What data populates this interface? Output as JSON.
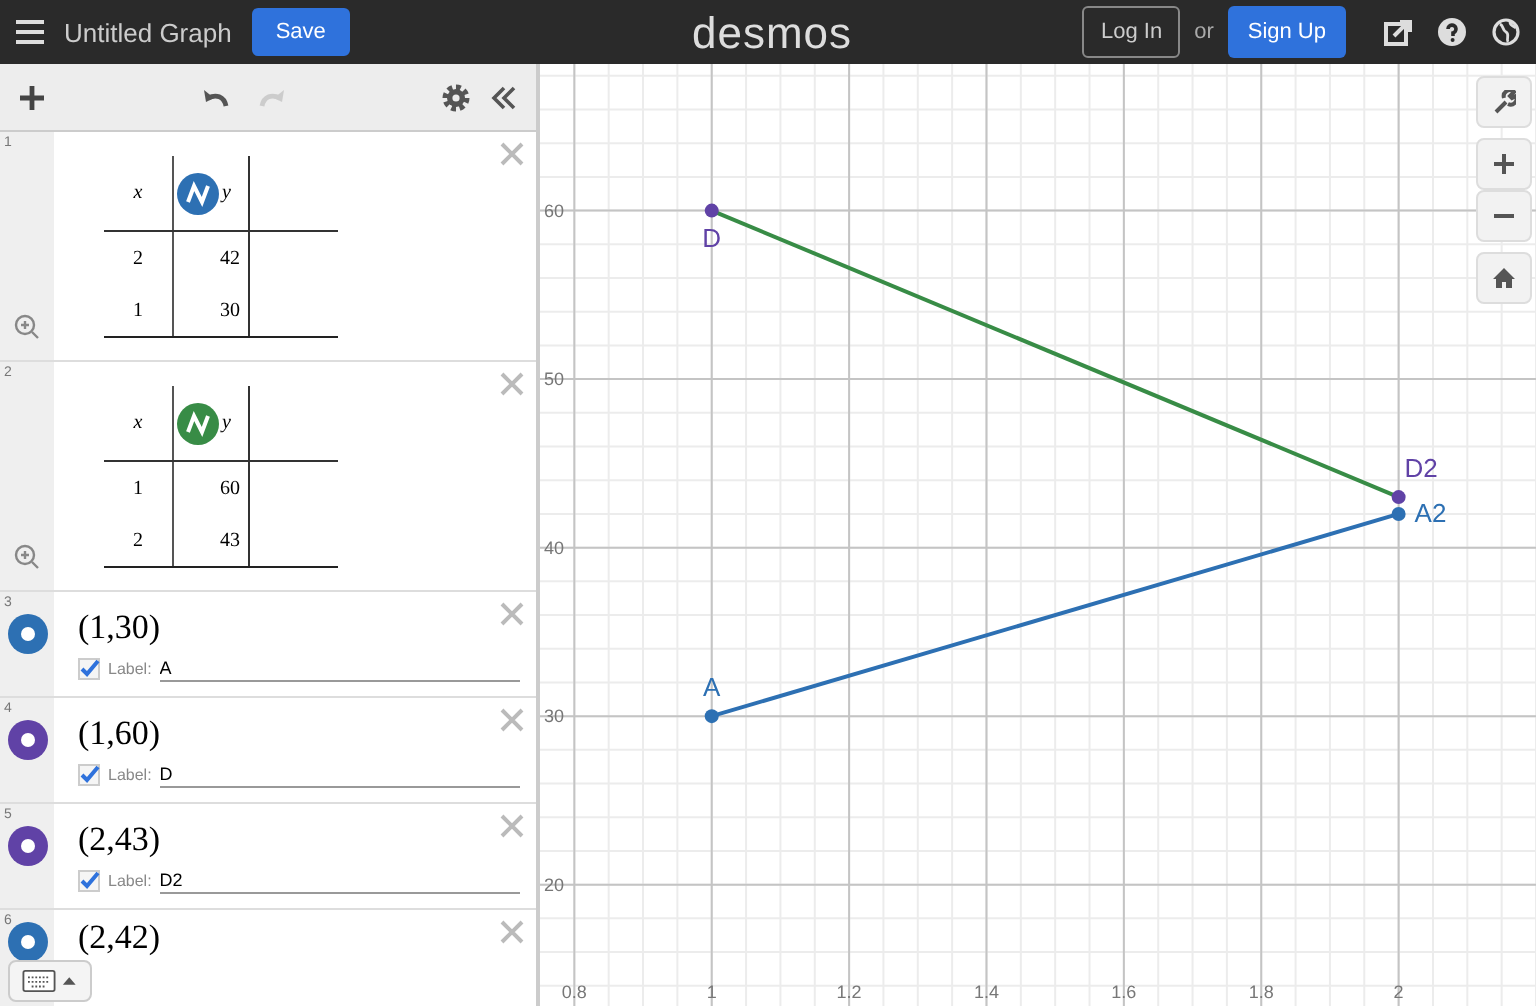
{
  "header": {
    "title": "Untitled Graph",
    "save": "Save",
    "logo": "desmos",
    "login": "Log In",
    "or": "or",
    "signup": "Sign Up"
  },
  "expressions": [
    {
      "kind": "table",
      "number": "1",
      "color": "#2d70b3",
      "columns": [
        "x",
        "y"
      ],
      "rows": [
        [
          "2",
          "42"
        ],
        [
          "1",
          "30"
        ]
      ]
    },
    {
      "kind": "table",
      "number": "2",
      "color": "#388c46",
      "columns": [
        "x",
        "y"
      ],
      "rows": [
        [
          "1",
          "60"
        ],
        [
          "2",
          "43"
        ]
      ]
    },
    {
      "kind": "point",
      "number": "3",
      "color": "#2d70b3",
      "latex": "(1,30)",
      "label_caption": "Label:",
      "label_checked": true,
      "label": "A"
    },
    {
      "kind": "point",
      "number": "4",
      "color": "#6042a6",
      "latex": "(1,60)",
      "label_caption": "Label:",
      "label_checked": true,
      "label": "D"
    },
    {
      "kind": "point",
      "number": "5",
      "color": "#6042a6",
      "latex": "(2,43)",
      "label_caption": "Label:",
      "label_checked": true,
      "label": "D2"
    },
    {
      "kind": "point",
      "number": "6",
      "color": "#2d70b3",
      "latex": "(2,42)"
    }
  ],
  "graph": {
    "chart_data": {
      "type": "line",
      "x": [
        1,
        2
      ],
      "series": [
        {
          "color": "#2d70b3",
          "values": [
            30,
            42
          ],
          "marker": "circle"
        },
        {
          "color": "#388c46",
          "values": [
            60,
            43
          ],
          "marker": "circle"
        }
      ],
      "grid": true,
      "xlim": [
        0.75,
        2.2
      ],
      "ylim": [
        12.8,
        68.7
      ],
      "xticks": [
        0.8,
        1,
        1.2,
        1.4,
        1.6,
        1.8,
        2
      ],
      "yticks": [
        20,
        30,
        40,
        50,
        60
      ]
    },
    "point_labels": [
      "A",
      "D",
      "D2",
      "A2"
    ]
  }
}
